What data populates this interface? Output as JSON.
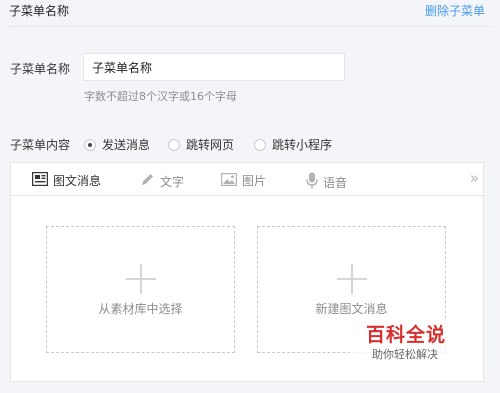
{
  "header": {
    "title": "子菜单名称",
    "delete_label": "删除子菜单"
  },
  "name_field": {
    "label": "子菜单名称",
    "value": "子菜单名称",
    "hint": "字数不超过8个汉字或16个字母"
  },
  "content": {
    "label": "子菜单内容",
    "options": [
      {
        "label": "发送消息",
        "checked": true
      },
      {
        "label": "跳转网页",
        "checked": false
      },
      {
        "label": "跳转小程序",
        "checked": false
      }
    ]
  },
  "editor": {
    "tabs": [
      {
        "label": "图文消息",
        "icon": "news-icon",
        "active": true
      },
      {
        "label": "文字",
        "icon": "pencil-icon",
        "active": false
      },
      {
        "label": "图片",
        "icon": "image-icon",
        "active": false
      },
      {
        "label": "语音",
        "icon": "microphone-icon",
        "active": false
      }
    ],
    "cards": [
      {
        "label": "从素材库中选择"
      },
      {
        "label": "新建图文消息"
      }
    ]
  },
  "watermark": {
    "main": "百科全说",
    "sub": "助你轻松解决"
  }
}
